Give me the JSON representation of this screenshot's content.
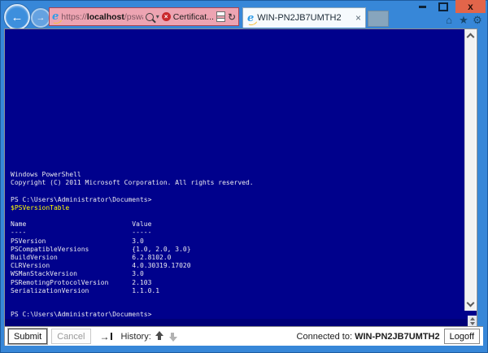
{
  "browser": {
    "back_icon": "←",
    "forward_icon": "→",
    "ie_logo_glyph": "e",
    "url": {
      "scheme": "https://",
      "host": "localhost",
      "path": "/pswa/console.as"
    },
    "caret_icon": "▾",
    "cert_button_label": "Certificat...",
    "cert_x_icon": "×",
    "refresh_icon": "↻",
    "tab": {
      "title": "WIN-PN2JB7UMTH2",
      "close_icon": "×"
    },
    "close_glyph": "x",
    "home_icon": "⌂",
    "favorites_icon": "★",
    "tools_icon": "⚙"
  },
  "console": {
    "background": "#00018c",
    "text_color": "#ebebf0",
    "command_color": "#ffff00",
    "output_lines": [
      "Windows PowerShell",
      "Copyright (C) 2011 Microsoft Corporation. All rights reserved.",
      "",
      "PS C:\\Users\\Administrator\\Documents>",
      {
        "text": "$PSVersionTable",
        "color": "#ffff00"
      },
      "",
      "Name                           Value",
      "----                           -----",
      "PSVersion                      3.0",
      "PSCompatibleVersions           {1.0, 2.0, 3.0}",
      "BuildVersion                   6.2.8102.0",
      "CLRVersion                     4.0.30319.17020",
      "WSManStackVersion              3.0",
      "PSRemotingProtocolVersion      2.103",
      "SerializationVersion           1.1.0.1",
      "",
      ""
    ],
    "input_prompt": "PS C:\\Users\\Administrator\\Documents>"
  },
  "version_table": {
    "columns": [
      "Name",
      "Value"
    ],
    "rows": [
      [
        "PSVersion",
        "3.0"
      ],
      [
        "PSCompatibleVersions",
        "{1.0, 2.0, 3.0}"
      ],
      [
        "BuildVersion",
        "6.2.8102.0"
      ],
      [
        "CLRVersion",
        "4.0.30319.17020"
      ],
      [
        "WSManStackVersion",
        "3.0"
      ],
      [
        "PSRemotingProtocolVersion",
        "2.103"
      ],
      [
        "SerializationVersion",
        "1.1.0.1"
      ]
    ]
  },
  "status_bar": {
    "submit_label": "Submit",
    "cancel_label": "Cancel",
    "history_label": "History:",
    "connected_label": "Connected to:",
    "server_name": "WIN-PN2JB7UMTH2",
    "logoff_label": "Logoff"
  },
  "colors": {
    "chrome_blue": "#3787d8",
    "url_bar_alert": "#eda4b2",
    "close_button": "#e2654a",
    "console_navy": "#00018c",
    "input_navy": "#000078"
  }
}
